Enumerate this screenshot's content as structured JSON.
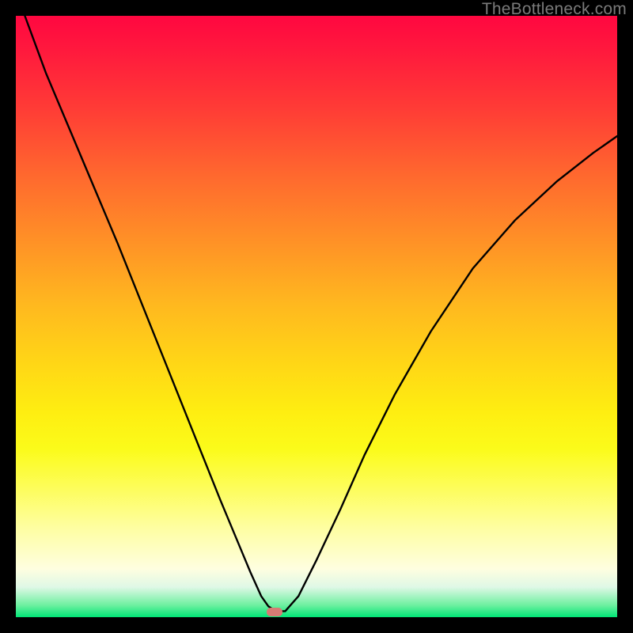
{
  "watermark": "TheBottleneck.com",
  "marker": {
    "x_frac": 0.43,
    "y_frac": 0.991
  },
  "chart_data": {
    "type": "line",
    "title": "",
    "xlabel": "",
    "ylabel": "",
    "xlim": [
      0,
      1
    ],
    "ylim": [
      0,
      1
    ],
    "series": [
      {
        "name": "curve",
        "x": [
          0.015,
          0.05,
          0.09,
          0.13,
          0.17,
          0.21,
          0.25,
          0.28,
          0.31,
          0.34,
          0.365,
          0.39,
          0.408,
          0.42,
          0.432,
          0.448,
          0.47,
          0.5,
          0.54,
          0.58,
          0.63,
          0.69,
          0.76,
          0.83,
          0.9,
          0.96,
          1.0
        ],
        "y": [
          1.0,
          0.905,
          0.81,
          0.715,
          0.62,
          0.52,
          0.42,
          0.345,
          0.27,
          0.195,
          0.135,
          0.075,
          0.035,
          0.018,
          0.01,
          0.01,
          0.035,
          0.095,
          0.18,
          0.27,
          0.37,
          0.475,
          0.58,
          0.66,
          0.725,
          0.772,
          0.8
        ]
      }
    ],
    "marker": {
      "x": 0.43,
      "y": 0.009
    }
  }
}
